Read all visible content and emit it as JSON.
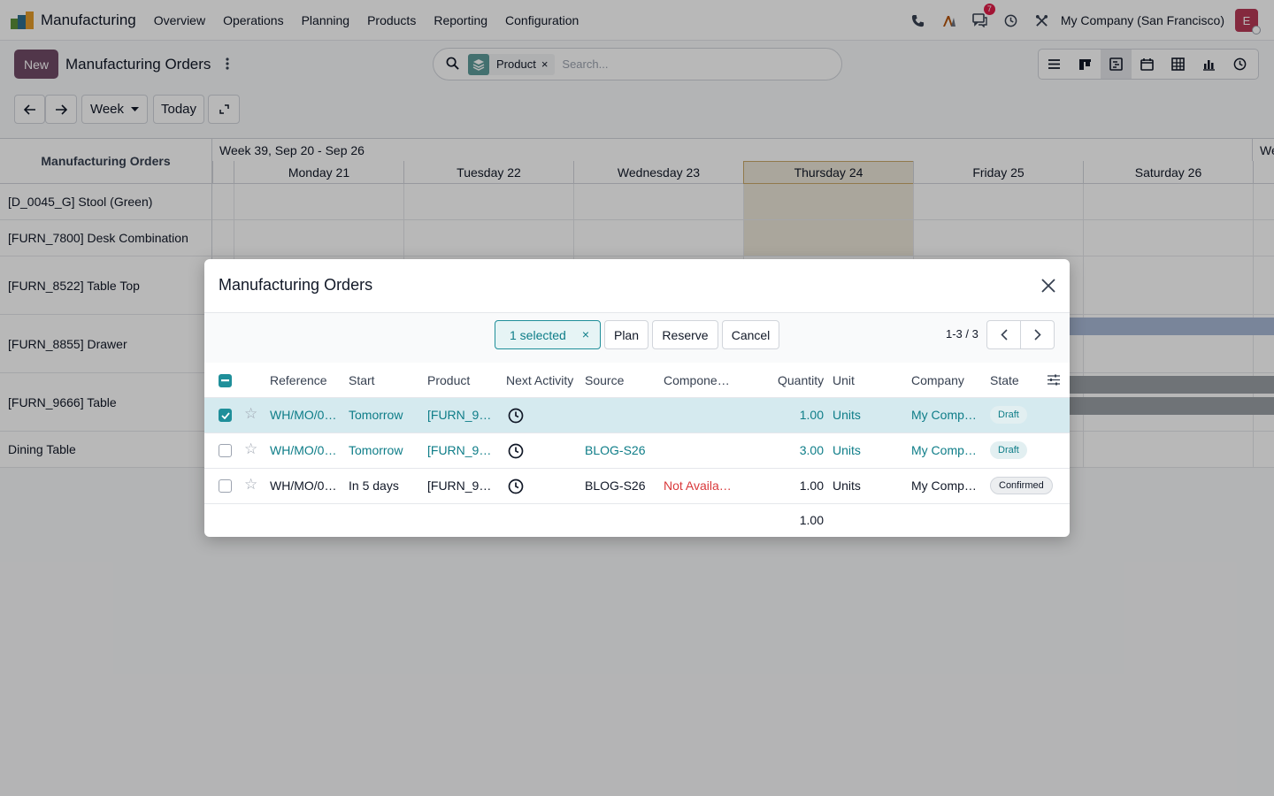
{
  "navbar": {
    "app_name": "Manufacturing",
    "menu": [
      "Overview",
      "Operations",
      "Planning",
      "Products",
      "Reporting",
      "Configuration"
    ],
    "messages_badge": "7",
    "company": "My Company (San Francisco)",
    "avatar_letter": "E"
  },
  "control_panel": {
    "new_label": "New",
    "title": "Manufacturing Orders",
    "search": {
      "facet_label": "Product",
      "facet_remove": "×",
      "placeholder": "Search..."
    },
    "views": [
      "list-view-icon",
      "kanban-view-icon",
      "gantt-view-icon",
      "calendar-view-icon",
      "pivot-view-icon",
      "graph-view-icon",
      "activity-view-icon"
    ],
    "active_view": "gantt-view-icon",
    "scale_label": "Week",
    "today_label": "Today"
  },
  "gantt": {
    "header": "Manufacturing Orders",
    "week_label": "Week 39, Sep 20 - Sep 26",
    "next_week_label": "We",
    "days": [
      "Monday 21",
      "Tuesday 22",
      "Wednesday 23",
      "Thursday 24",
      "Friday 25",
      "Saturday 26"
    ],
    "today": "Thursday 24",
    "rows": [
      "[D_0045_G] Stool (Green)",
      "[FURN_7800] Desk Combination",
      "[FURN_8522] Table Top",
      "[FURN_8855] Drawer",
      "[FURN_9666] Table",
      "Dining Table"
    ]
  },
  "dialog": {
    "title": "Manufacturing Orders",
    "selection_label": "1 selected",
    "selection_clear": "×",
    "actions": {
      "plan": "Plan",
      "reserve": "Reserve",
      "cancel": "Cancel"
    },
    "pager": "1-3 / 3",
    "columns": {
      "reference": "Reference",
      "start": "Start",
      "product": "Product",
      "next_activity": "Next Activity",
      "source": "Source",
      "components": "Compone…",
      "quantity": "Quantity",
      "unit": "Unit",
      "company": "Company",
      "state": "State"
    },
    "rows": [
      {
        "selected": true,
        "reference": "WH/MO/0…",
        "start": "Tomorrow",
        "product": "[FURN_9…",
        "source": "",
        "components": "",
        "quantity": "1.00",
        "unit": "Units",
        "company": "My Comp…",
        "state": "Draft"
      },
      {
        "selected": false,
        "reference": "WH/MO/0…",
        "start": "Tomorrow",
        "product": "[FURN_9…",
        "source": "BLOG-S26",
        "components": "",
        "quantity": "3.00",
        "unit": "Units",
        "company": "My Comp…",
        "state": "Draft"
      },
      {
        "selected": false,
        "reference": "WH/MO/0…",
        "start": "In 5 days",
        "product": "[FURN_9…",
        "source": "BLOG-S26",
        "components": "Not Availa…",
        "quantity": "1.00",
        "unit": "Units",
        "company": "My Comp…",
        "state": "Confirmed"
      }
    ],
    "total_quantity": "1.00"
  },
  "colors": {
    "brand": "#714b67",
    "accent": "#0e7d88",
    "selected_row": "#d5eaef",
    "danger": "#d9383a"
  }
}
